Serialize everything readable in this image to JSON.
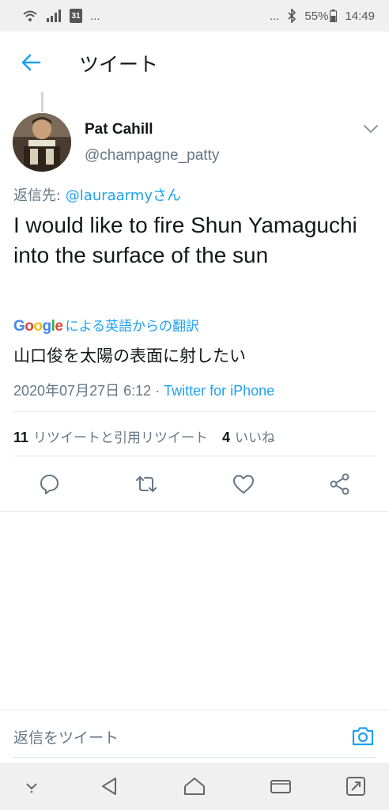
{
  "status": {
    "left_dots": "...",
    "calendar_day": "31",
    "right_dots": "...",
    "battery": "55%",
    "time": "14:49"
  },
  "header": {
    "title": "ツイート"
  },
  "tweet": {
    "author_name": "Pat Cahill",
    "author_handle": "@champagne_patty",
    "reply_prefix": "返信先: ",
    "reply_mention": "@lauraarmyさん",
    "text": "I would like to fire Shun Yamaguchi into the surface of the sun",
    "translate_label": "による英語からの翻訳",
    "translated_text": "山口俊を太陽の表面に射したい",
    "timestamp": "2020年07月27日 6:12 · ",
    "via": "Twitter for iPhone"
  },
  "stats": {
    "retweets_count": "11",
    "retweets_label": "リツイートと引用リツイート",
    "likes_count": "4",
    "likes_label": "いいね"
  },
  "compose": {
    "placeholder": "返信をツイート"
  },
  "colors": {
    "accent": "#1da1f2",
    "muted": "#657786",
    "text": "#14171a"
  },
  "icons": [
    "wifi-icon",
    "signal-icon",
    "calendar-icon",
    "bluetooth-icon",
    "battery-icon",
    "back-arrow-icon",
    "chevron-down-icon",
    "reply-icon",
    "retweet-icon",
    "like-icon",
    "share-icon",
    "camera-icon",
    "nav-down-icon",
    "nav-back-icon",
    "nav-home-icon",
    "nav-recents-icon",
    "nav-expand-icon"
  ]
}
